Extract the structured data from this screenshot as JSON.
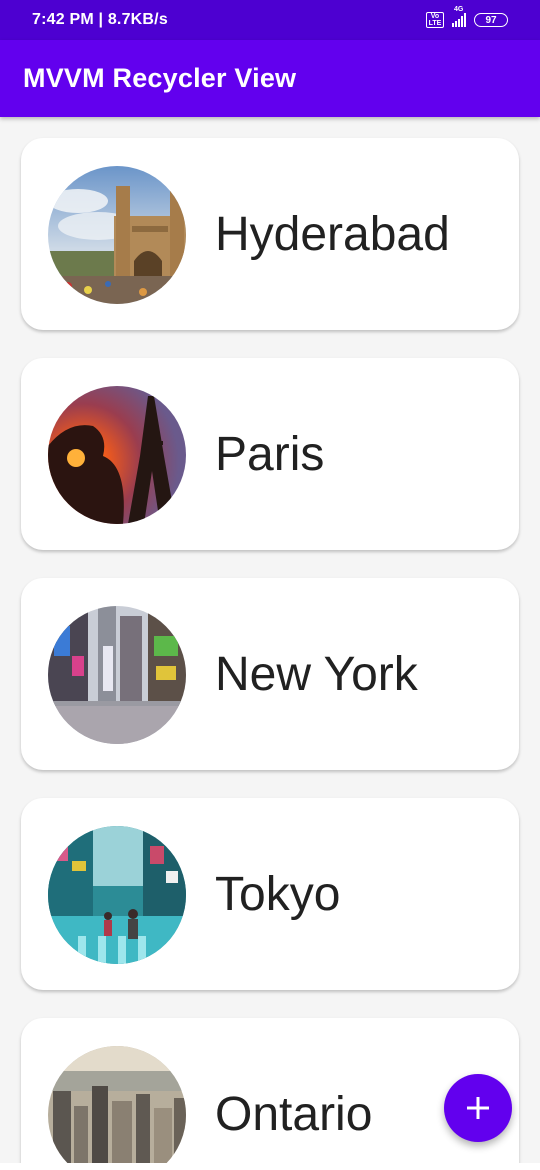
{
  "status_bar": {
    "time_speed": "7:42 PM | 8.7KB/s",
    "volte_top": "Vo",
    "volte_bottom": "LTE",
    "network": "4G",
    "battery": "97"
  },
  "app_bar": {
    "title": "MVVM Recycler View",
    "color": "#6200ee"
  },
  "cities": [
    {
      "name": "Hyderabad",
      "image": "charminar-photo"
    },
    {
      "name": "Paris",
      "image": "eiffel-tower-sunset-photo"
    },
    {
      "name": "New York",
      "image": "times-square-photo"
    },
    {
      "name": "Tokyo",
      "image": "shibuya-street-photo"
    },
    {
      "name": "Ontario",
      "image": "toronto-skyline-photo"
    }
  ],
  "fab": {
    "icon": "plus-icon"
  }
}
